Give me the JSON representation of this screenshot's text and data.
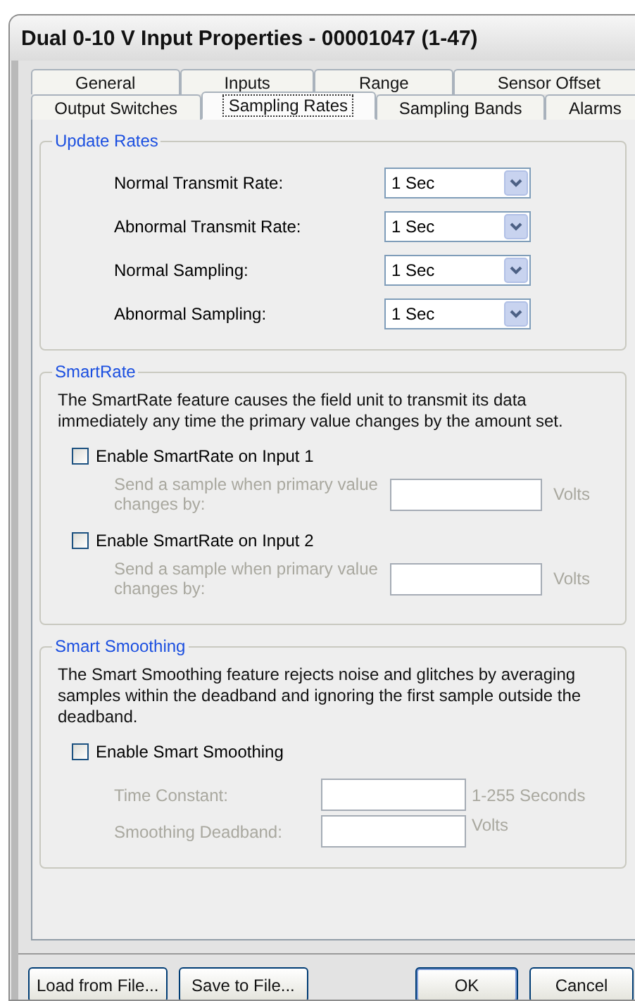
{
  "window": {
    "title": "Dual 0-10 V Input Properties - 00001047 (1-47)"
  },
  "tab_rows": [
    {
      "tabs": [
        {
          "label": "General",
          "selected": false
        },
        {
          "label": "Inputs",
          "selected": false
        },
        {
          "label": "Range",
          "selected": false
        },
        {
          "label": "Sensor Offset",
          "selected": false
        }
      ]
    },
    {
      "tabs": [
        {
          "label": "Output Switches",
          "selected": false
        },
        {
          "label": "Sampling Rates",
          "selected": true
        },
        {
          "label": "Sampling Bands",
          "selected": false
        },
        {
          "label": "Alarms",
          "selected": false
        }
      ]
    }
  ],
  "update_rates": {
    "title": "Update Rates",
    "rows": [
      {
        "label": "Normal Transmit Rate:",
        "value": "1 Sec"
      },
      {
        "label": "Abnormal Transmit Rate:",
        "value": "1 Sec"
      },
      {
        "label": "Normal Sampling:",
        "value": "1 Sec"
      },
      {
        "label": "Abnormal Sampling:",
        "value": "1 Sec"
      }
    ]
  },
  "smart_rate": {
    "title": "SmartRate",
    "description": "The SmartRate feature causes the field unit to transmit its data immediately any time the primary value changes by the amount set.",
    "inputs": [
      {
        "label": "Enable SmartRate on Input 1",
        "checked": false,
        "prompt": "Send a sample when primary value changes by:",
        "unit": "Volts",
        "disabled": true
      },
      {
        "label": "Enable SmartRate on Input 2",
        "checked": false,
        "prompt": "Send a sample when primary value changes by:",
        "unit": "Volts",
        "disabled": true
      }
    ]
  },
  "smart_smoothing": {
    "title": "Smart Smoothing",
    "description": "The Smart Smoothing feature rejects noise and glitches by averaging samples within the deadband and ignoring the first sample outside the deadband.",
    "checkbox": {
      "label": "Enable Smart Smoothing",
      "checked": false
    },
    "fields": [
      {
        "label": "Time Constant:",
        "unit": "1-255 Seconds",
        "disabled": true
      },
      {
        "label": "Smoothing Deadband:",
        "unit": "Volts",
        "disabled": true
      }
    ]
  },
  "buttons": [
    {
      "label": "Load from File...",
      "default": false
    },
    {
      "label": "Save to File...",
      "default": false
    },
    {
      "label": "OK",
      "default": true
    },
    {
      "label": "Cancel",
      "default": false
    }
  ]
}
